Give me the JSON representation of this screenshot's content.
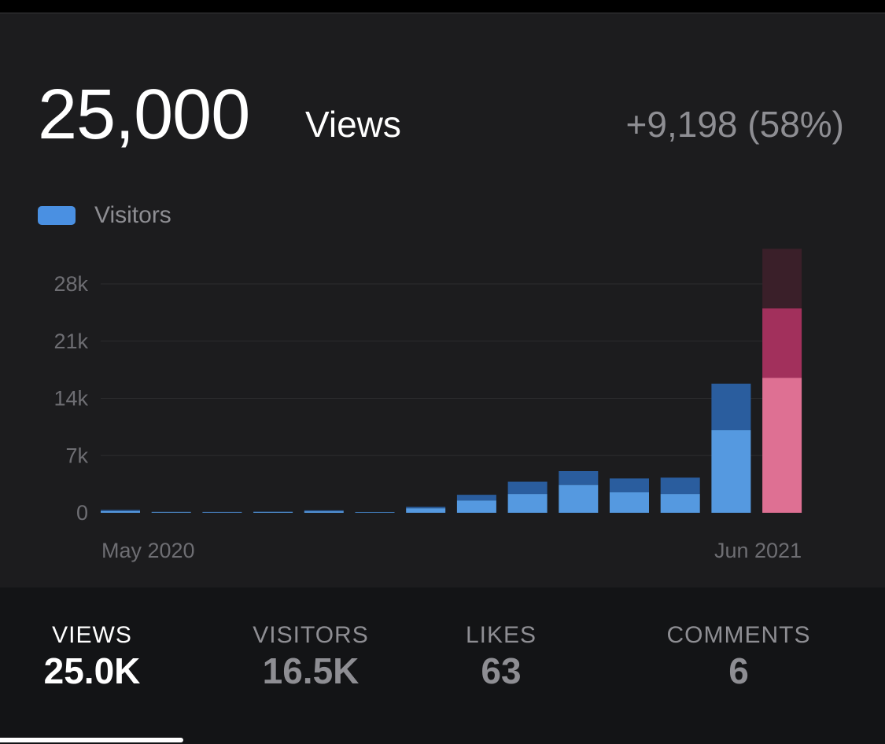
{
  "header": {
    "total_value": "25,000",
    "total_unit": "Views",
    "change": "+9,198 (58%)"
  },
  "legend": {
    "label": "Visitors",
    "color": "#4a90e2"
  },
  "colors": {
    "views_bar": "#2a5d9e",
    "visitors_bar": "#5599e0",
    "current_views_bar": "#a2305c",
    "current_visitors_bar": "#de7093",
    "current_overflow": "#3a1f29",
    "grid": "#2c2c2e"
  },
  "chart_data": {
    "type": "bar",
    "categories": [
      "May 2020",
      "",
      "",
      "",
      "",
      "",
      "",
      "",
      "",
      "",
      "",
      "",
      "",
      "Jun 2021"
    ],
    "x_tick_labels": [
      "May 2020",
      "Jun 2021"
    ],
    "y_ticks": [
      "0",
      "7k",
      "14k",
      "21k",
      "28k"
    ],
    "ylim": [
      0,
      32000
    ],
    "series": [
      {
        "name": "Visitors",
        "values": [
          200,
          80,
          70,
          90,
          180,
          60,
          550,
          1500,
          2300,
          3400,
          2500,
          2300,
          10100,
          16500
        ]
      },
      {
        "values": [
          350,
          120,
          110,
          140,
          300,
          100,
          720,
          2200,
          3800,
          5100,
          4200,
          4300,
          15800,
          25000
        ]
      }
    ],
    "current_bar_range_top": 32300,
    "grid": true
  },
  "stats": [
    {
      "label": "VIEWS",
      "value": "25.0K",
      "active": true
    },
    {
      "label": "VISITORS",
      "value": "16.5K",
      "active": false
    },
    {
      "label": "LIKES",
      "value": "63",
      "active": false
    },
    {
      "label": "COMMENTS",
      "value": "6",
      "active": false
    }
  ]
}
